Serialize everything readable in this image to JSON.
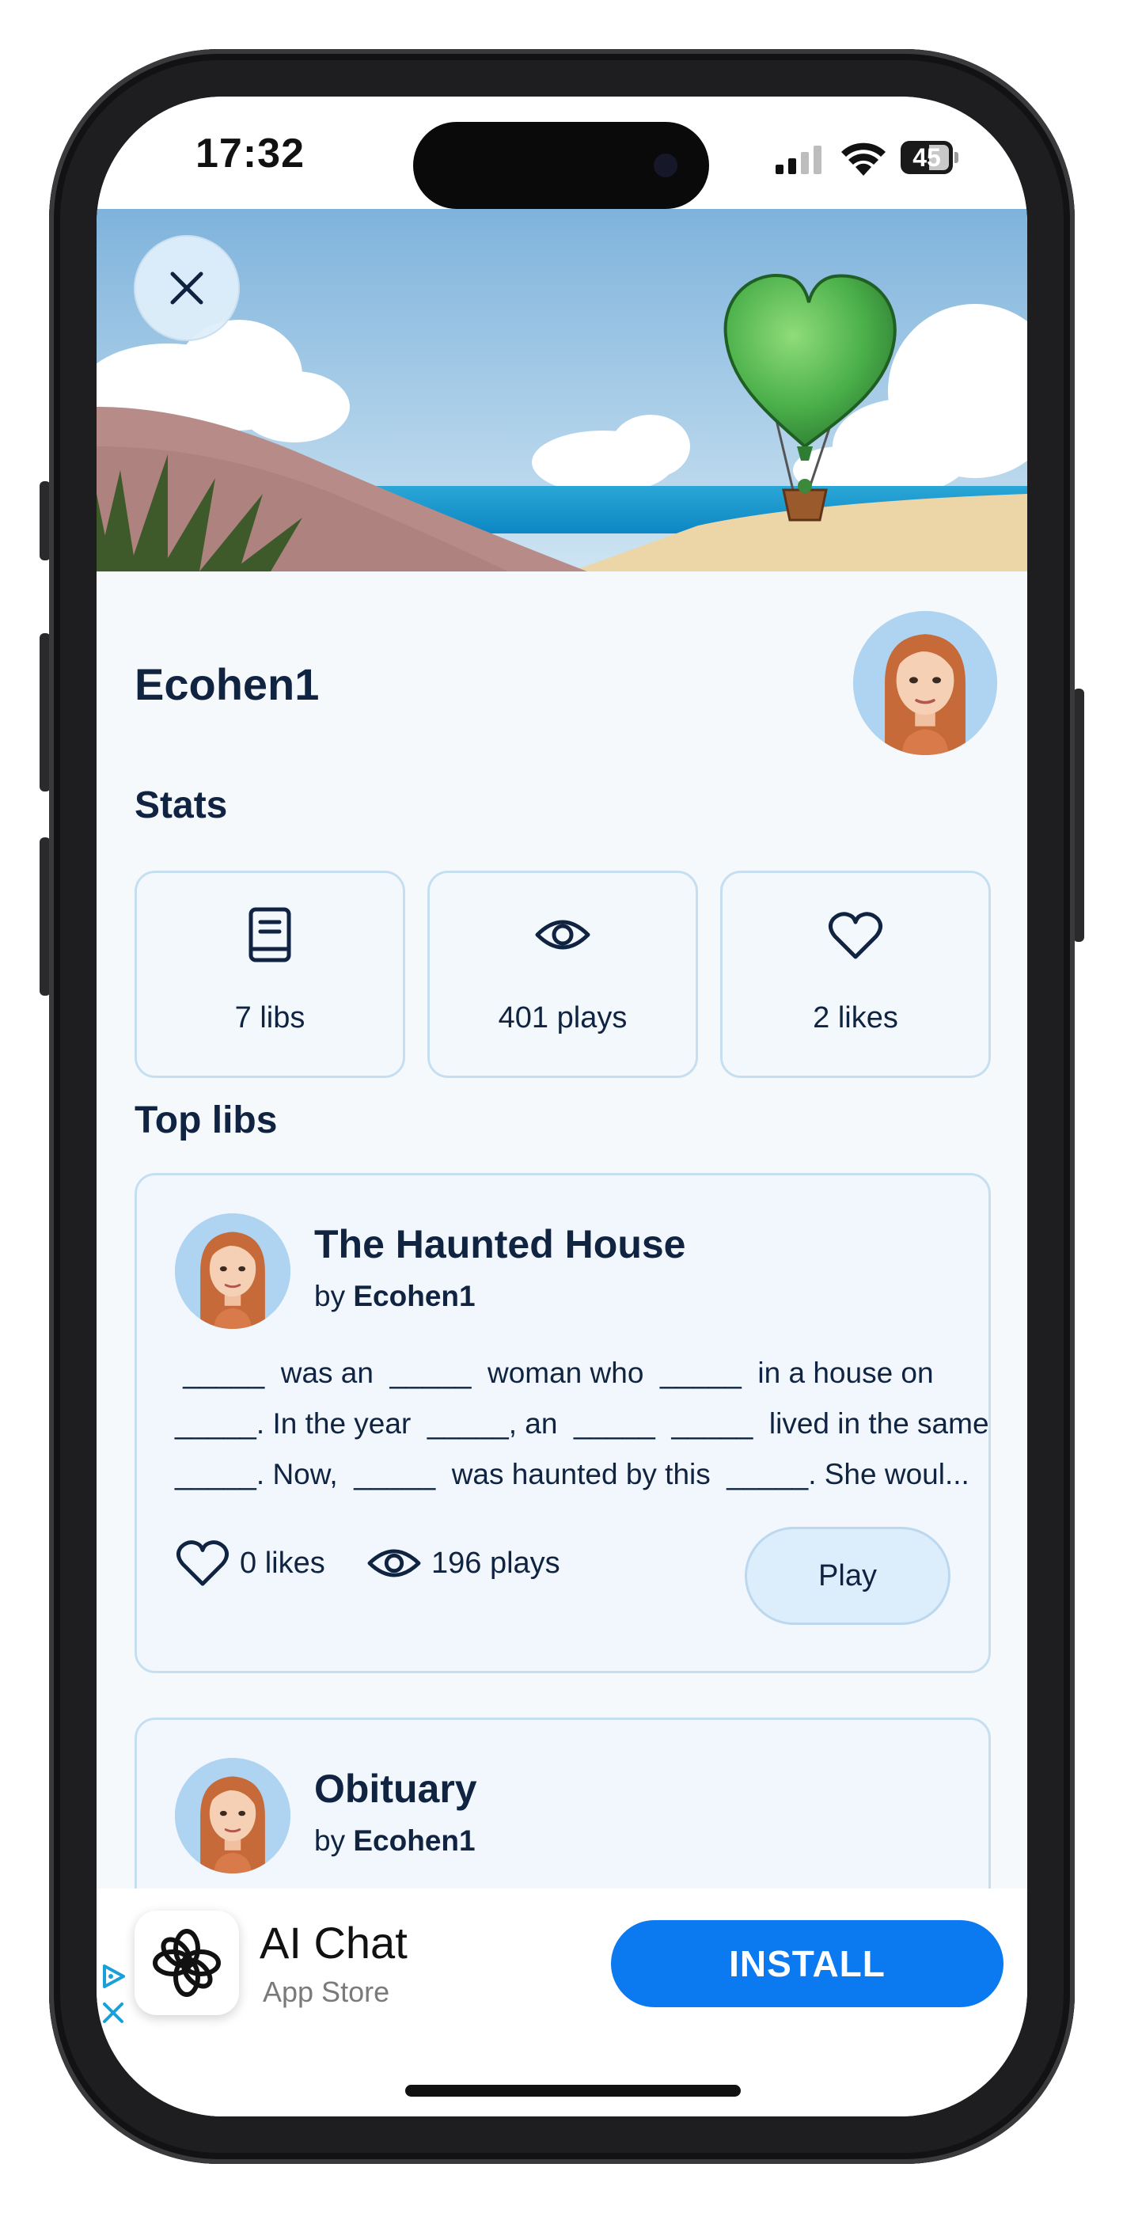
{
  "status_bar": {
    "time": "17:32",
    "battery": "45"
  },
  "profile": {
    "username": "Ecohen1"
  },
  "stats": {
    "title": "Stats",
    "items": [
      {
        "icon": "book-icon",
        "label": "7 libs"
      },
      {
        "icon": "eye-icon",
        "label": "401 plays"
      },
      {
        "icon": "heart-icon",
        "label": "2 likes"
      }
    ]
  },
  "top_libs": {
    "title": "Top libs",
    "items": [
      {
        "title": "The Haunted House",
        "by": "by",
        "author": "Ecohen1",
        "excerpt_lines": [
          " _____  was an  _____  woman who  _____  in a house on",
          "_____. In the year  _____, an  _____  _____  lived in the same",
          "_____. Now,  _____  was haunted by this  _____. She woul..."
        ],
        "likes": "0 likes",
        "plays": "196 plays",
        "play_label": "Play"
      },
      {
        "title": "Obituary",
        "by": "by",
        "author": "Ecohen1"
      }
    ]
  },
  "ad": {
    "title": "AI Chat",
    "subtitle": "App Store",
    "install_label": "INSTALL",
    "install_color": "#0b7af0"
  },
  "colors": {
    "text_primary": "#102442",
    "card_border": "#c6dff0",
    "background": "#f5f9fc"
  }
}
